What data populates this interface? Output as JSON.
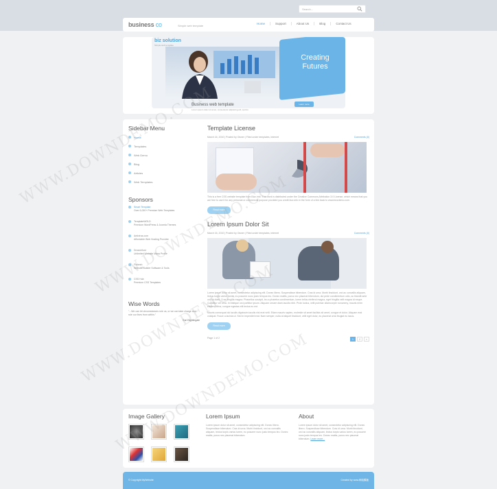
{
  "header": {
    "search_placeholder": "Search...",
    "logo_main": "business",
    "logo_accent": "co",
    "tagline": "Simple web template",
    "nav": [
      "Home",
      "Support",
      "About Us",
      "Blog",
      "Contact Us"
    ]
  },
  "banner": {
    "brand": "biz solution",
    "brand_sub": "Simple web template",
    "headline_1": "Creating",
    "headline_2": "Futures",
    "caption": "Business web template",
    "caption_sub": "Lorem ipsum dolor sit amet, consectetur adipiscing elit, sed do",
    "button": "Learn more"
  },
  "sidebar": {
    "menu_title": "Sidebar Menu",
    "menu": [
      "Home",
      "Templates",
      "Web Demo",
      "Blog",
      "Articles",
      "Web Templates"
    ],
    "sponsors_title": "Sponsors",
    "sponsors": [
      {
        "name": "Smart Template",
        "desc": "Over 6,000+ Premium Web Templates"
      },
      {
        "name": "TemplateWOLD",
        "desc": "Premium WordPress & Joomla Themes"
      },
      {
        "name": "Antivirus.com",
        "desc": "Affordable Web Hosting Provider"
      },
      {
        "name": "DreamHost",
        "desc": "Unlimited Website Mana Profile"
      },
      {
        "name": "Flahesh",
        "desc": "Website Builder Software & Tools"
      },
      {
        "name": "CSS Hub",
        "desc": "Premium CSS Templates"
      }
    ],
    "wise_title": "Wise Words",
    "wise_text": "\"...We can let circumstances rule us, or we can take charge and rule our lives from within.\"",
    "wise_author": "Earl Nightingale"
  },
  "posts": [
    {
      "title": "Template License",
      "meta": "March 16, 2010 | Posted by Owner | Filed under templates, internet",
      "comments": "Comments (0)",
      "excerpt": "This is a free CSS website template from Bizz.info. This work is distributed under the Creative Commons Attribution 3.0 License, which means that you are free to use it for any personal or commercial purpose provided you credit bizz.info in the form of a link back to www.bizzdemo.com.",
      "button": "Read more"
    },
    {
      "title": "Lorem Ipsum Dolor Sit",
      "meta": "March 16, 2010 | Posted by Owner | Filed under templates, internet",
      "comments": "Comments (0)",
      "excerpt": "Lorem ipsum dolor sit amet, consectetur adipiscing elit. Donec libero. Suspendisse bibendum. Cras id urna. Morbi tincidunt, orci ac convallis aliquam, lectus turpis varius lorem, eu posuere nunc justo tempus leo. Donec mattis, purus nec placerat bibendum, dui pede condimentum odio, ac blandit ante orci ut diam. Cras fringilla magna. Phasellus suscipit, leo a pharetra condimentum, lorem tellus eleifend magna, eget fringilla velit magna id neque. Curabitur vel urna. In tristique orci porttitor ipsum. Aliquam ornare diam iaculis nibh. Proin luctus, velit pulvinar ullamcorper nonummy, mauris enim eleifend urna, congue egestas elit lectus eu est.",
      "excerpt_2": "Mauris consequat dui iaculis dignissim iaculis nisl erat velit. Etiam mauris sapien, molestie sit amet facilisis sit amet, congue et dolor. Aliquam erat volutpat. Fusce a lacinia ut. Sed in imperdiet erat. Nam semper, nulla at aliquet tincidunt, velit eget dolor, eu placerat urna feugiat eu lacus.",
      "button": "Read more"
    }
  ],
  "pager": {
    "label": "Page 1 of 2",
    "pages": [
      "1",
      "2",
      "»"
    ]
  },
  "footer": {
    "gallery_title": "Image Gallery",
    "lorem_title": "Lorem Ipsum",
    "lorem_text": "Lorem ipsum dolor sit amet, consectetur adipiscing elit. Donec libero. Suspendisse bibendum. Cras id urna. Morbi tincidunt, orci ac convallis aliquam, lectus turpis varius lorem, eu posuere nunc justo tempus leo. Donec mattis, purus nec placerat bibendum.",
    "about_title": "About",
    "about_text": "Lorem ipsum dolor sit amet, consectetur adipiscing elit. Donec libero. Suspendisse bibendum. Cras id urna. Morbi tincidunt, orci ac convallis aliquam, lectus turpis varius lorem, eu posuere nunc justo tempus leo. Donec mattis, purus nec placerat bibendum.",
    "about_link": "Learn more...",
    "copyright": "© Copyright MyWebsite",
    "credit": "Created by www.网站模板",
    "watermark": "WWW.DOWNDEMO.COM"
  }
}
